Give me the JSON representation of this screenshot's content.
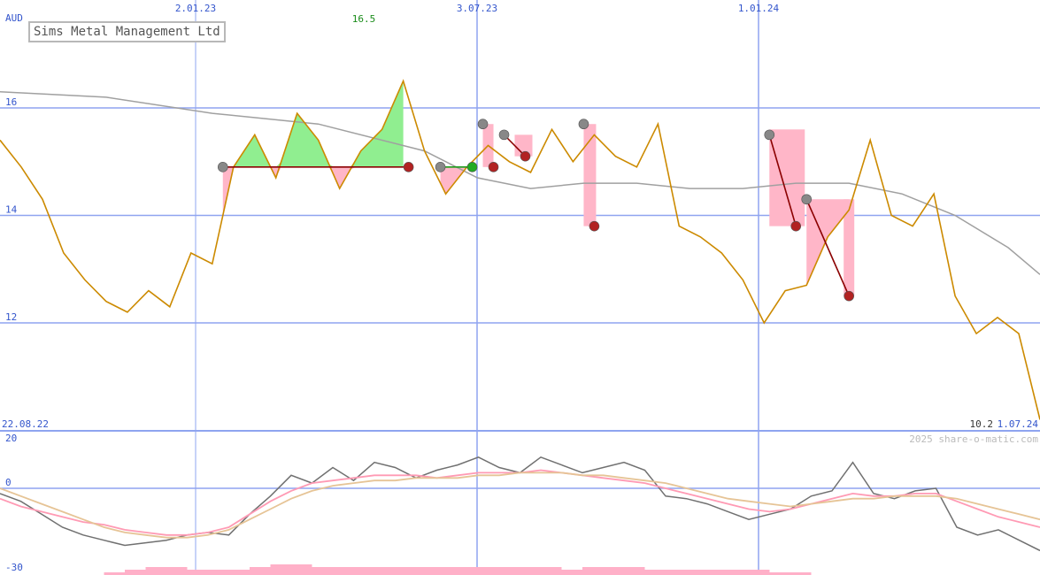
{
  "chart_title": "Sims Metal Management Ltd",
  "currency": "AUD",
  "peak_label": "16.5",
  "start_date": "22.08.22",
  "end_label": "10.2",
  "end_date": "1.07.24",
  "watermark": "2025 share-o-matic.com",
  "colors": {
    "price": "#cc8a00",
    "average": "#a0a0a0",
    "gain_fill": "#90ee90",
    "loss_fill": "#ffb6c8",
    "grid": "#8fa4f0",
    "trade_loss_line": "#8b0000",
    "trade_gain_line": "#1a9c1a",
    "volume": "#ffb0c8",
    "osc_main": "#707070",
    "osc_fast": "#ff9ab4",
    "osc_slow": "#e6c496"
  },
  "chart_data": {
    "type": "line",
    "title": "Sims Metal Management Ltd",
    "ylabel": "AUD",
    "ylim": [
      10.2,
      16.9
    ],
    "yticks": [
      12,
      14,
      16
    ],
    "x_date_labels": [
      "2.01.23",
      "3.07.23",
      "1.01.24"
    ],
    "series": [
      {
        "name": "price",
        "x": [
          0,
          2,
          4,
          6,
          8,
          10,
          12,
          14,
          16,
          18,
          20,
          22,
          24,
          26,
          28,
          30,
          32,
          34,
          36,
          38,
          40,
          42,
          44,
          46,
          48,
          50,
          52,
          54,
          56,
          58,
          60,
          62,
          64,
          66,
          68,
          70,
          72,
          74,
          76,
          78,
          80,
          82,
          84,
          86,
          88,
          90,
          92,
          94,
          96,
          98
        ],
        "y": [
          15.4,
          14.9,
          14.3,
          13.3,
          12.8,
          12.4,
          12.2,
          12.6,
          12.3,
          13.3,
          13.1,
          14.9,
          15.5,
          14.7,
          15.9,
          15.4,
          14.5,
          15.2,
          15.6,
          16.5,
          15.2,
          14.4,
          14.9,
          15.3,
          15.0,
          14.8,
          15.6,
          15.0,
          15.5,
          15.1,
          14.9,
          15.7,
          13.8,
          13.6,
          13.3,
          12.8,
          12.0,
          12.6,
          12.7,
          13.6,
          14.1,
          15.4,
          14.0,
          13.8,
          14.4,
          12.5,
          11.8,
          12.1,
          11.8,
          10.2
        ]
      },
      {
        "name": "average",
        "x": [
          0,
          10,
          20,
          30,
          40,
          45,
          50,
          55,
          60,
          65,
          70,
          75,
          80,
          85,
          90,
          95,
          98
        ],
        "y": [
          16.3,
          16.2,
          15.9,
          15.7,
          15.2,
          14.7,
          14.5,
          14.6,
          14.6,
          14.5,
          14.5,
          14.6,
          14.6,
          14.4,
          14.0,
          13.4,
          12.9
        ]
      }
    ],
    "annotations": [
      "16.5",
      "10.2"
    ],
    "oscillator": {
      "ylim": [
        -30,
        20
      ],
      "yticks": [
        20,
        0,
        -30
      ],
      "series": [
        {
          "name": "osc_main",
          "values": [
            -2,
            -5,
            -10,
            -15,
            -18,
            -20,
            -22,
            -21,
            -20,
            -18,
            -17,
            -18,
            -10,
            -3,
            5,
            2,
            8,
            3,
            10,
            8,
            4,
            7,
            9,
            12,
            8,
            6,
            12,
            9,
            6,
            8,
            10,
            7,
            -3,
            -4,
            -6,
            -9,
            -12,
            -10,
            -8,
            -3,
            -1,
            10,
            -2,
            -4,
            -1,
            0,
            -15,
            -18,
            -16,
            -20,
            -24
          ]
        },
        {
          "name": "osc_fast",
          "values": [
            -4,
            -7,
            -9,
            -11,
            -13,
            -14,
            -16,
            -17,
            -18,
            -18,
            -17,
            -15,
            -10,
            -5,
            -1,
            2,
            3,
            4,
            5,
            5,
            5,
            4,
            5,
            6,
            6,
            6,
            7,
            6,
            5,
            4,
            3,
            2,
            0,
            -2,
            -4,
            -6,
            -8,
            -9,
            -8,
            -6,
            -4,
            -2,
            -3,
            -3,
            -2,
            -2,
            -5,
            -8,
            -11,
            -13,
            -15
          ]
        },
        {
          "name": "osc_slow",
          "values": [
            0,
            -3,
            -6,
            -9,
            -12,
            -15,
            -17,
            -18,
            -19,
            -19,
            -18,
            -16,
            -12,
            -8,
            -4,
            -1,
            1,
            2,
            3,
            3,
            4,
            4,
            4,
            5,
            5,
            6,
            6,
            6,
            5,
            5,
            4,
            3,
            2,
            0,
            -2,
            -4,
            -5,
            -6,
            -7,
            -6,
            -5,
            -4,
            -4,
            -3,
            -3,
            -3,
            -4,
            -6,
            -8,
            -10,
            -12
          ]
        }
      ]
    },
    "volume": {
      "values": [
        0,
        0,
        0,
        0,
        0,
        1,
        2,
        3,
        3,
        2,
        2,
        2,
        3,
        4,
        4,
        3,
        3,
        3,
        3,
        3,
        3,
        3,
        3,
        3,
        3,
        3,
        3,
        2,
        3,
        3,
        3,
        2,
        2,
        2,
        2,
        2,
        2,
        1,
        1,
        0,
        0,
        0,
        0,
        0,
        0,
        0,
        0,
        0,
        0,
        0
      ]
    }
  }
}
